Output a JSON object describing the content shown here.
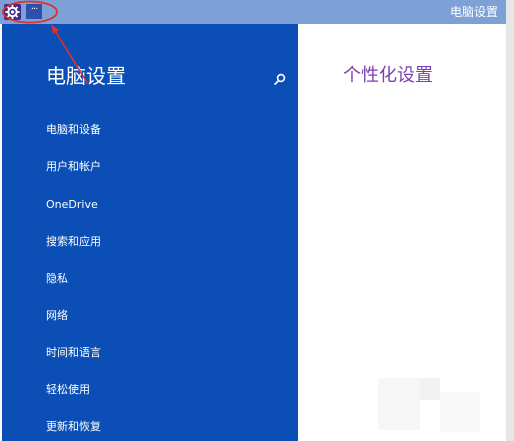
{
  "window": {
    "title": "电脑设置",
    "menu_button_label": "···"
  },
  "sidebar": {
    "title": "电脑设置",
    "items": [
      {
        "label": "电脑和设备"
      },
      {
        "label": "用户和帐户"
      },
      {
        "label": "OneDrive"
      },
      {
        "label": "搜索和应用"
      },
      {
        "label": "隐私"
      },
      {
        "label": "网络"
      },
      {
        "label": "时间和语言"
      },
      {
        "label": "轻松使用"
      },
      {
        "label": "更新和恢复"
      }
    ]
  },
  "main": {
    "title": "个性化设置"
  },
  "icons": {
    "app": "settings-gear-icon",
    "search": "search-icon"
  },
  "colors": {
    "titlebar": "#7da0d6",
    "sidebar": "#0b4fb6",
    "content_title": "#7b3fb0",
    "annotation": "#e0302a"
  }
}
